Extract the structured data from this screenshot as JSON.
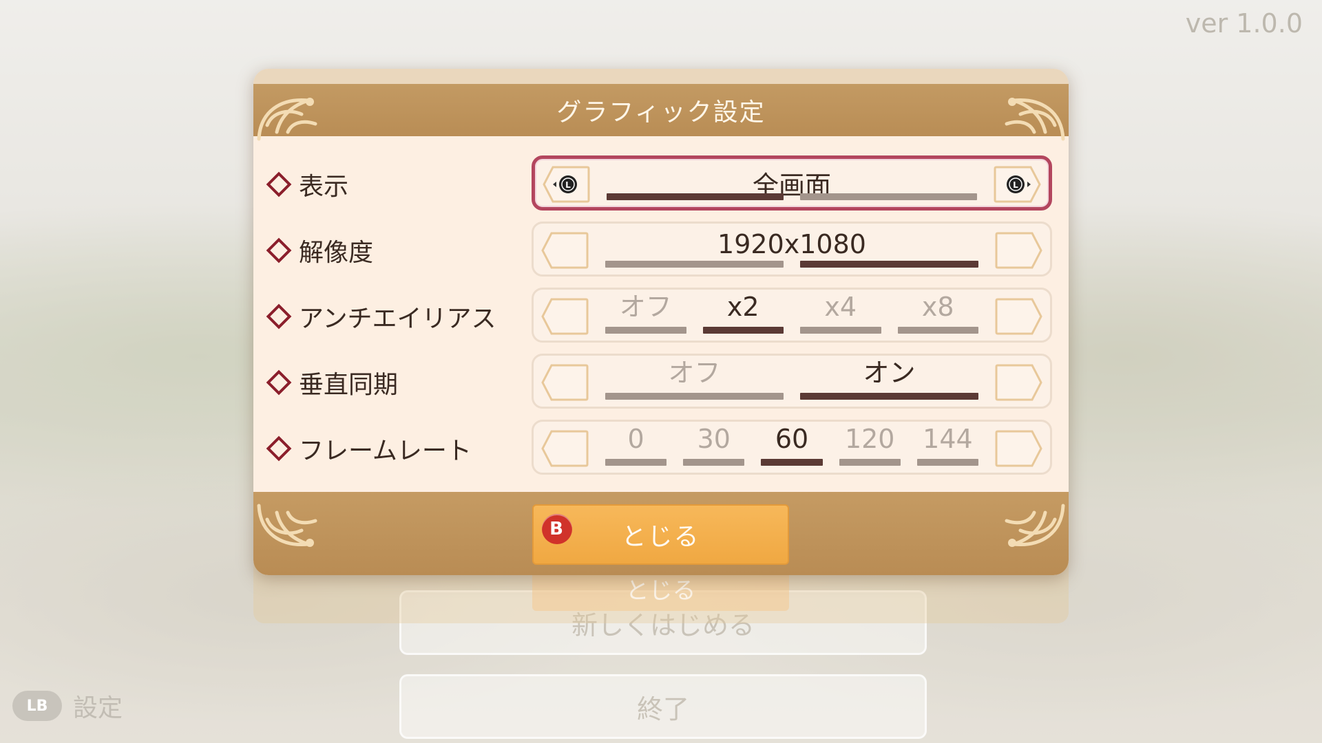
{
  "version": "ver 1.0.0",
  "background": {
    "menu_title": "設定",
    "menu_items": [
      "新しくはじめる",
      "終了"
    ],
    "close_ghost": "とじる",
    "lb_hint": {
      "button": "LB",
      "label": "設定"
    }
  },
  "dialog": {
    "title": "グラフィック設定",
    "rows": [
      {
        "label": "表示",
        "type": "single",
        "value": "全画面",
        "bars": 2,
        "selected_bar": 0,
        "active": true
      },
      {
        "label": "解像度",
        "type": "single",
        "value": "1920x1080",
        "bars": 2,
        "selected_bar": 1,
        "active": false
      },
      {
        "label": "アンチエイリアス",
        "type": "options",
        "options": [
          "オフ",
          "x2",
          "x4",
          "x8"
        ],
        "selected": 1,
        "active": false
      },
      {
        "label": "垂直同期",
        "type": "options",
        "options": [
          "オフ",
          "オン"
        ],
        "selected": 1,
        "active": false
      },
      {
        "label": "フレームレート",
        "type": "options",
        "options": [
          "0",
          "30",
          "60",
          "120",
          "144"
        ],
        "selected": 2,
        "active": false
      }
    ],
    "close_button": {
      "label": "とじる",
      "badge": "B"
    }
  },
  "colors": {
    "header": "#bf955d",
    "panel": "#fdefe2",
    "active_border": "#b3465e",
    "close_button": "#f3ad4b",
    "badge": "#d0322a"
  }
}
